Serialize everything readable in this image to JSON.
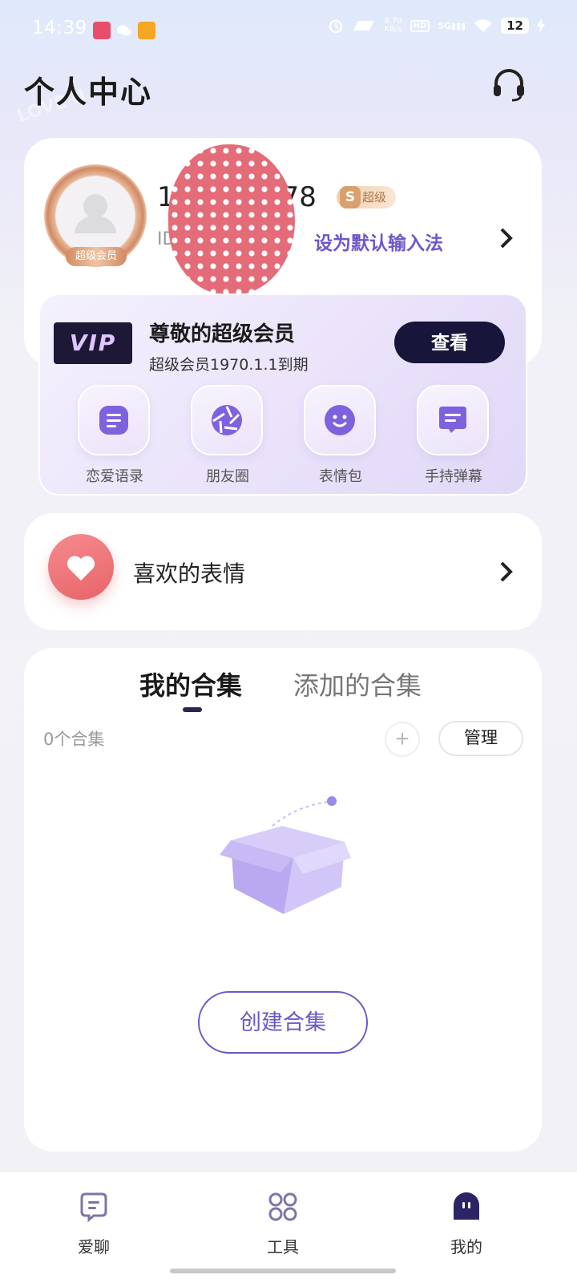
{
  "status_bar": {
    "time": "14:39",
    "network_speed_value": "9.70",
    "network_speed_unit": "KB/s",
    "hd": "HD",
    "signal": "5G",
    "battery": "12"
  },
  "header": {
    "title": "个人中心"
  },
  "profile": {
    "name_start": "1",
    "name_end": "078",
    "level_badge": "超级",
    "level_letter": "S",
    "id_prefix": "ID",
    "id_suffix": "7·",
    "set_default_link": "设为默认输入法",
    "avatar_badge": "超级会员"
  },
  "vip": {
    "logo_text": "VIP",
    "title": "尊敬的超级会员",
    "subtitle": "超级会员1970.1.1到期",
    "view_button": "查看",
    "features": [
      {
        "label": "恋爱语录",
        "icon": "document-icon"
      },
      {
        "label": "朋友圈",
        "icon": "aperture-icon"
      },
      {
        "label": "表情包",
        "icon": "smiley-icon"
      },
      {
        "label": "手持弹幕",
        "icon": "message-icon"
      }
    ]
  },
  "favorites": {
    "label": "喜欢的表情"
  },
  "collections": {
    "tabs": [
      "我的合集",
      "添加的合集"
    ],
    "count_text": "0个合集",
    "add_symbol": "+",
    "manage_button": "管理",
    "create_button": "创建合集"
  },
  "bottom_nav": {
    "items": [
      {
        "label": "爱聊",
        "icon": "chat-icon"
      },
      {
        "label": "工具",
        "icon": "grid-icon"
      },
      {
        "label": "我的",
        "icon": "profile-face-icon"
      }
    ],
    "active_index": 2
  },
  "colors": {
    "accent": "#6e56c9",
    "dark_button": "#17163a",
    "heart": "#e76468"
  }
}
